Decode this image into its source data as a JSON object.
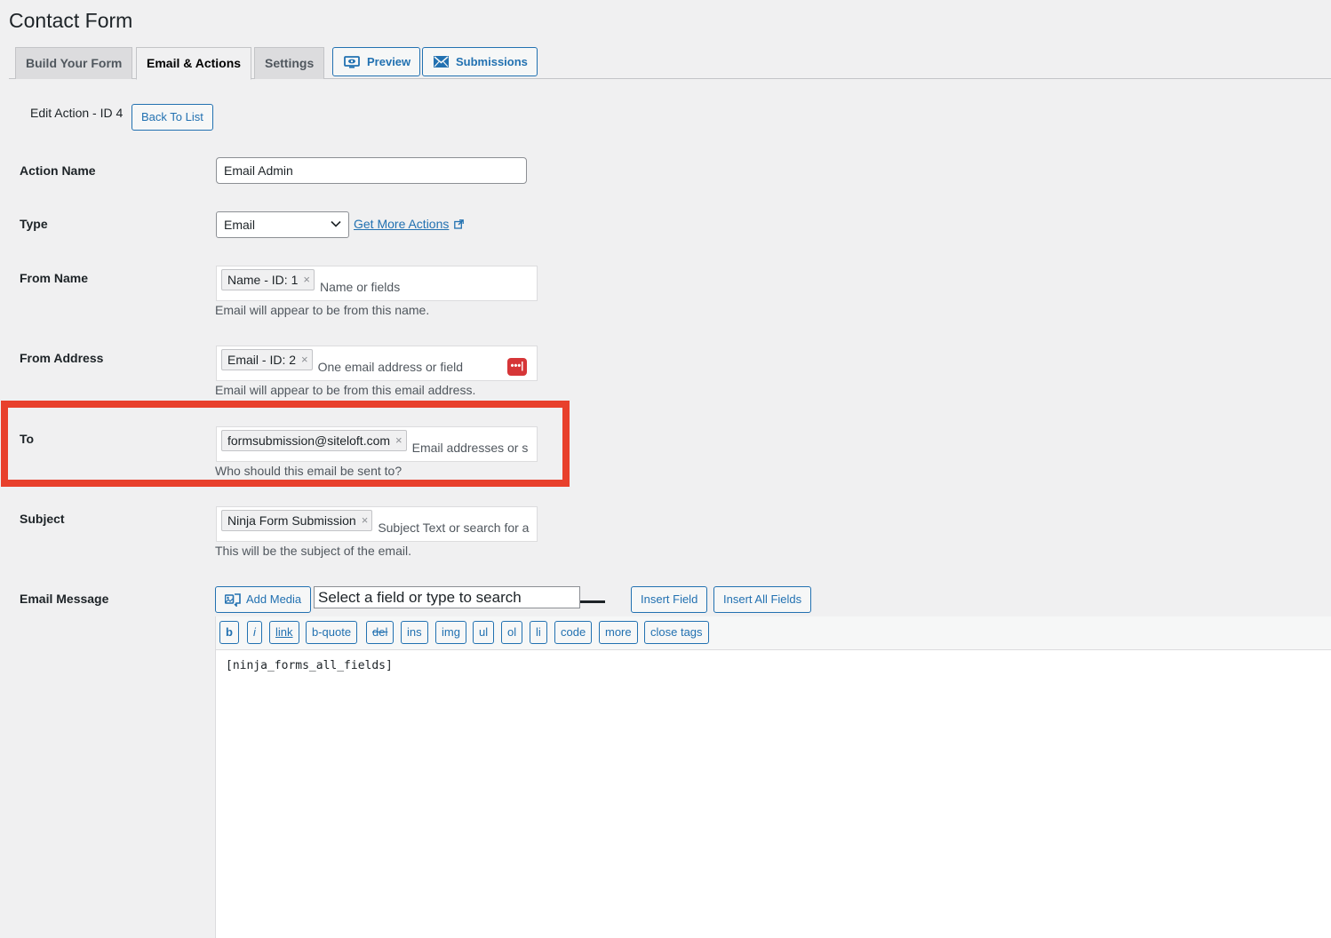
{
  "page": {
    "title": "Contact Form"
  },
  "tabs": [
    {
      "label": "Build Your Form"
    },
    {
      "label": "Email & Actions"
    },
    {
      "label": "Settings"
    }
  ],
  "tab_buttons": {
    "preview": "Preview",
    "submissions": "Submissions"
  },
  "edit": {
    "label": "Edit Action - ID 4",
    "back_button": "Back To List"
  },
  "fields": {
    "action_name": {
      "label": "Action Name",
      "value": "Email Admin"
    },
    "type": {
      "label": "Type",
      "selected": "Email",
      "more_link": "Get More Actions"
    },
    "from_name": {
      "label": "From Name",
      "chip": "Name - ID: 1",
      "placeholder": "Name or fields",
      "description": "Email will appear to be from this name."
    },
    "from_address": {
      "label": "From Address",
      "chip": "Email - ID: 2",
      "placeholder": "One email address or field",
      "description": "Email will appear to be from this email address.",
      "password_manager_icon": "•••|"
    },
    "to": {
      "label": "To",
      "chip": "formsubmission@siteloft.com",
      "placeholder": "Email addresses or s",
      "description": "Who should this email be sent to?"
    },
    "subject": {
      "label": "Subject",
      "chip": "Ninja Form Submission",
      "placeholder": "Subject Text or search for a",
      "description": "This will be the subject of the email."
    },
    "message": {
      "label": "Email Message",
      "add_media": "Add Media",
      "field_search_placeholder": "Select a field or type to search",
      "insert_field": "Insert Field",
      "insert_all_fields": "Insert All Fields",
      "quicktags": [
        "b",
        "i",
        "link",
        "b-quote",
        "del",
        "ins",
        "img",
        "ul",
        "ol",
        "li",
        "code",
        "more",
        "close tags"
      ],
      "content": "[ninja_forms_all_fields]"
    }
  },
  "colors": {
    "accent": "#2271b1",
    "highlight": "#e8402c",
    "background": "#f0f0f1"
  },
  "icons": {
    "remove": "×"
  }
}
